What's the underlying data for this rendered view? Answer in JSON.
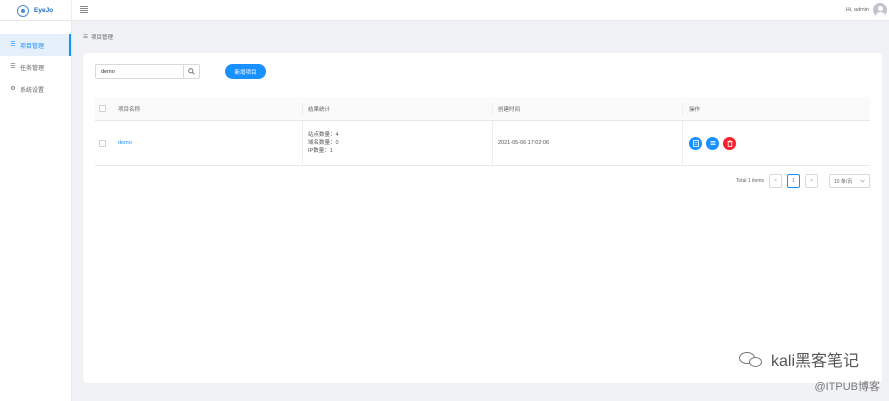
{
  "header": {
    "logo_text": "EyeJo",
    "greeting": "Hi, admin"
  },
  "sidebar": {
    "items": [
      {
        "label": "项目管理",
        "icon": "list-icon",
        "active": true
      },
      {
        "label": "任务管理",
        "icon": "tasks-icon",
        "active": false
      },
      {
        "label": "系统设置",
        "icon": "gear-icon",
        "active": false
      }
    ]
  },
  "breadcrumb": {
    "label": "项目管理"
  },
  "toolbar": {
    "search_value": "demo",
    "add_label": "新增项目"
  },
  "table": {
    "columns": [
      "项目名称",
      "结果统计",
      "创建时间",
      "操作"
    ],
    "rows": [
      {
        "name": "demo",
        "stats": [
          "站点数量：4",
          "域名数量：0",
          "IP数量：1"
        ],
        "created": "2021-05-06 17:02:06"
      }
    ]
  },
  "pagination": {
    "total": "Total 1 items",
    "prev": "<",
    "page": "1",
    "next": ">",
    "page_size": "10 条/页"
  },
  "watermark": {
    "text": "kali黑客笔记",
    "source": "@ITPUB博客"
  },
  "colors": {
    "accent": "#1890ff",
    "danger": "#f5222d",
    "background": "#f0f2f5"
  }
}
